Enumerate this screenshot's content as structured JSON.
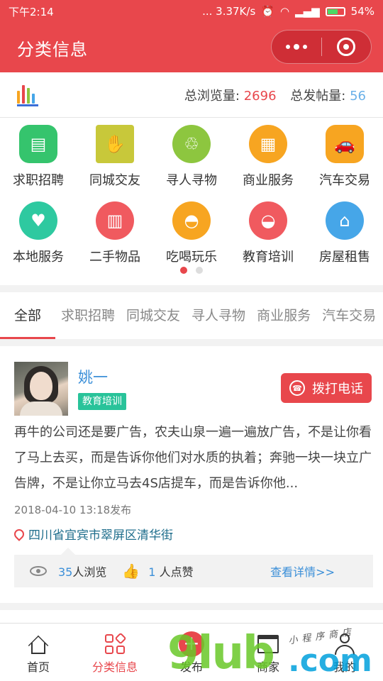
{
  "status_bar": {
    "time": "下午2:14",
    "network": "... 3.37K/s",
    "battery": "54%"
  },
  "header": {
    "title": "分类信息"
  },
  "stats": {
    "views_label": "总浏览量:",
    "views_value": "2696",
    "posts_label": "总发帖量:",
    "posts_value": "56"
  },
  "categories": [
    {
      "label": "求职招聘",
      "icon": "id-card-icon",
      "color": "#35c46d"
    },
    {
      "label": "同城交友",
      "icon": "handshake-icon",
      "color": "#c8c83a"
    },
    {
      "label": "寻人寻物",
      "icon": "hands-gift-icon",
      "color": "#8dc63f"
    },
    {
      "label": "商业服务",
      "icon": "grid-icon",
      "color": "#f7a521"
    },
    {
      "label": "汽车交易",
      "icon": "car-icon",
      "color": "#f7a521"
    },
    {
      "label": "本地服务",
      "icon": "location-heart-icon",
      "color": "#2ec9a0"
    },
    {
      "label": "二手物品",
      "icon": "basket-icon",
      "color": "#f05a5f"
    },
    {
      "label": "吃喝玩乐",
      "icon": "dish-cover-icon",
      "color": "#f7a521"
    },
    {
      "label": "教育培训",
      "icon": "bowl-icon",
      "color": "#f05a5f"
    },
    {
      "label": "房屋租售",
      "icon": "house-icon",
      "color": "#46a6e8"
    }
  ],
  "pager": {
    "pages": 2,
    "current": 1
  },
  "tabs": [
    "全部",
    "求职招聘",
    "同城交友",
    "寻人寻物",
    "商业服务",
    "汽车交易"
  ],
  "post": {
    "name": "姚一",
    "category": "教育培训",
    "call_label": "拨打电话",
    "description": "再牛的公司还是要广告，农夫山泉一遍一遍放广告，不是让你看了马上去买，而是告诉你他们对水质的执着；奔驰一块一块立广告牌，不是让你立马去4S店提车，而是告诉你他...",
    "date": "2018-04-10 13:18发布",
    "location": "四川省宜宾市翠屏区清华街",
    "views_count": "35",
    "views_suffix": "人浏览",
    "likes_count": "1",
    "likes_suffix": "人点赞",
    "detail_label": "查看详情>>"
  },
  "tabbar": [
    {
      "label": "首页",
      "icon": "home-icon"
    },
    {
      "label": "分类信息",
      "icon": "category-icon"
    },
    {
      "label": "发布",
      "icon": "plus-icon"
    },
    {
      "label": "商家",
      "icon": "shop-icon"
    },
    {
      "label": "我的",
      "icon": "user-icon"
    }
  ],
  "watermark": {
    "main": "9lub",
    "domain": ".com",
    "tagline": "小程序商店"
  },
  "colors": {
    "primary": "#e8474c",
    "link": "#3b8fd8",
    "badge": "#29c39a"
  }
}
